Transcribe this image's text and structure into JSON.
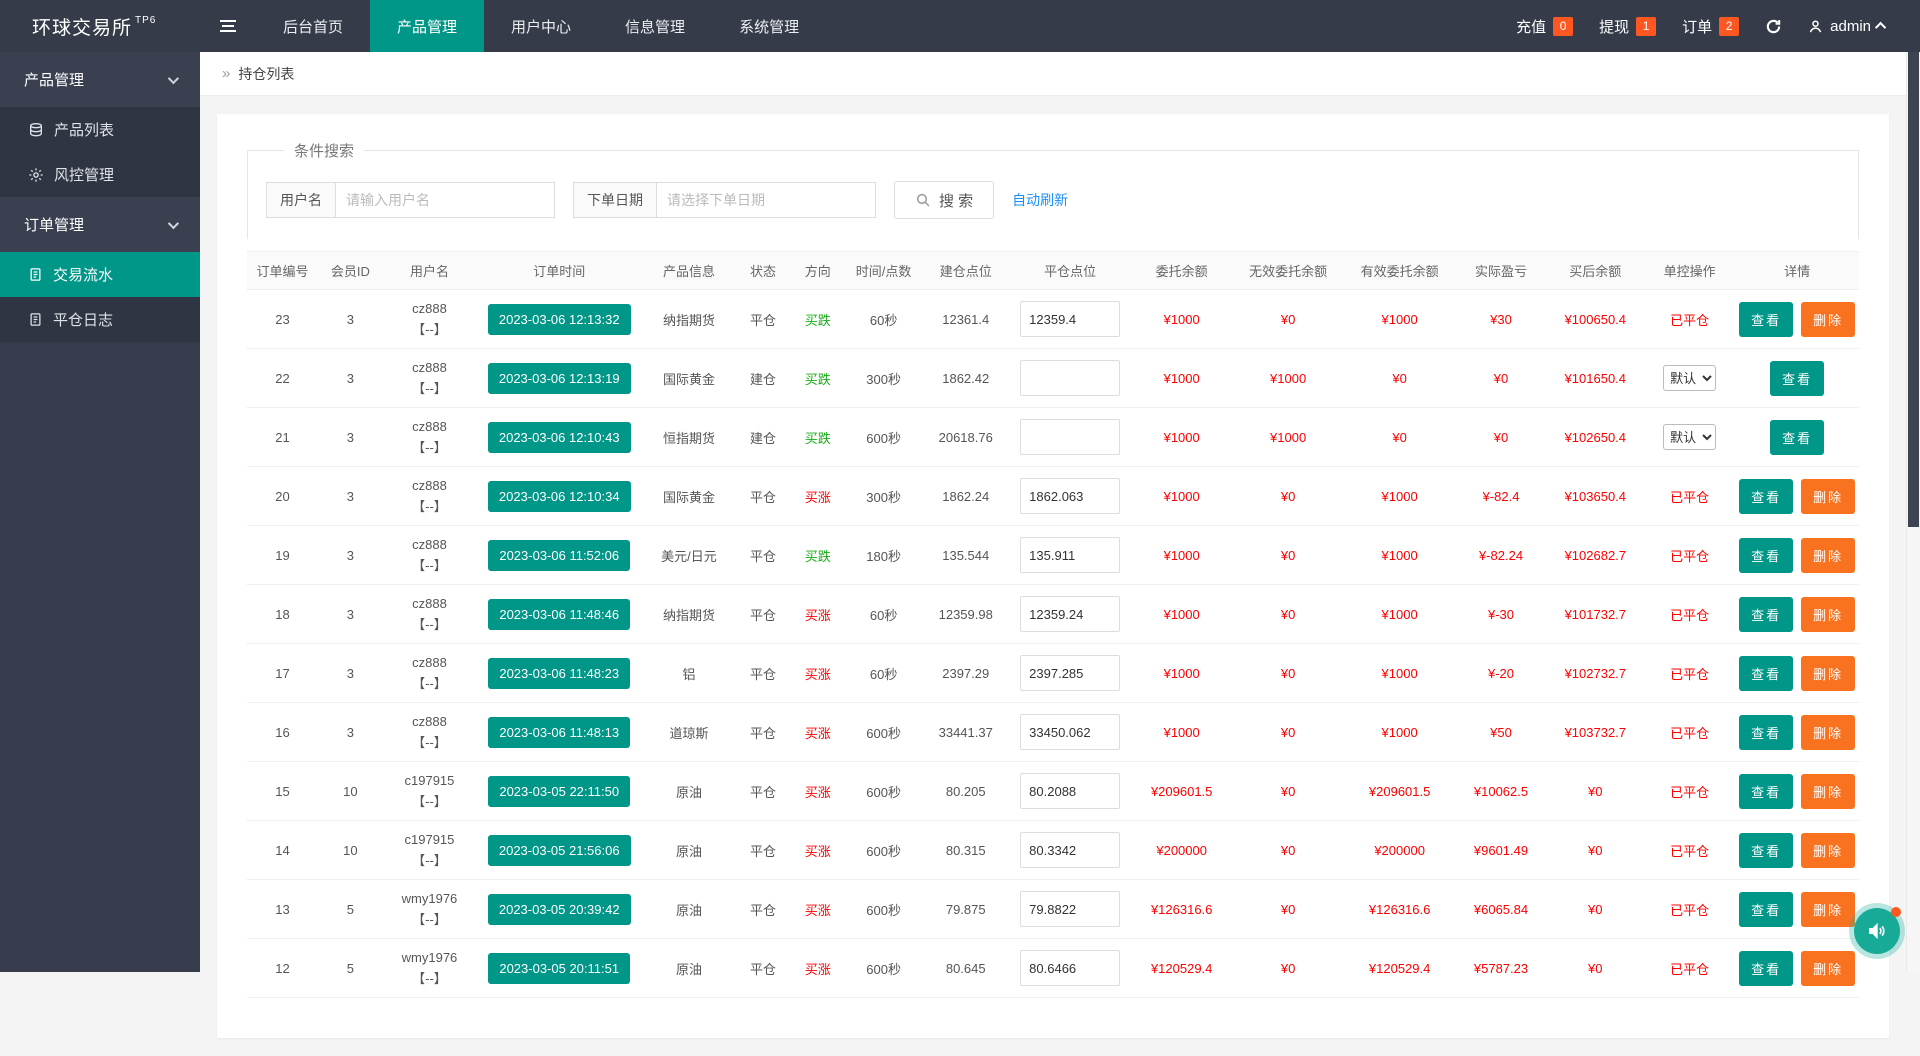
{
  "brand": {
    "title": "环球交易所",
    "superscript": "TP6"
  },
  "navbar": {
    "menu": [
      "后台首页",
      "产品管理",
      "用户中心",
      "信息管理",
      "系统管理"
    ],
    "active_index": 1,
    "quick": [
      {
        "label": "充值",
        "count": "0"
      },
      {
        "label": "提现",
        "count": "1"
      },
      {
        "label": "订单",
        "count": "2"
      }
    ],
    "user": "admin"
  },
  "sidebar": {
    "groups": [
      {
        "label": "产品管理",
        "items": [
          {
            "icon": "layers-icon",
            "label": "产品列表",
            "active": false
          },
          {
            "icon": "gear-icon",
            "label": "风控管理",
            "active": false
          }
        ]
      },
      {
        "label": "订单管理",
        "items": [
          {
            "icon": "document-icon",
            "label": "交易流水",
            "active": true
          },
          {
            "icon": "document-icon",
            "label": "平仓日志",
            "active": false
          }
        ]
      }
    ]
  },
  "breadcrumb": "持仓列表",
  "search": {
    "legend": "条件搜索",
    "username_label": "用户名",
    "username_placeholder": "请输入用户名",
    "date_label": "下单日期",
    "date_placeholder": "请选择下单日期",
    "search_button": "搜 索",
    "auto_refresh": "自动刷新"
  },
  "table": {
    "headers": [
      "订单编号",
      "会员ID",
      "用户名",
      "订单时间",
      "产品信息",
      "状态",
      "方向",
      "时间/点数",
      "建仓点位",
      "平仓点位",
      "委托余额",
      "无效委托余额",
      "有效委托余额",
      "实际盈亏",
      "买后余额",
      "单控操作",
      "详情"
    ],
    "view_label": "查看",
    "delete_label": "删除",
    "rows": [
      {
        "id": "23",
        "member_id": "3",
        "username": "cz888",
        "user_sub": "【--】",
        "time": "2023-03-06 12:13:32",
        "product": "纳指期货",
        "status": "平仓",
        "direction": "买跌",
        "direction_color": "green",
        "period": "60秒",
        "open_point": "12361.4",
        "close_point": "12359.4",
        "balance": "¥1000",
        "invalid_balance": "¥0",
        "valid_balance": "¥1000",
        "profit": "¥30",
        "after_balance": "¥100650.4",
        "control": "已平仓",
        "control_type": "text",
        "actions": [
          "查看",
          "删除"
        ]
      },
      {
        "id": "22",
        "member_id": "3",
        "username": "cz888",
        "user_sub": "【--】",
        "time": "2023-03-06 12:13:19",
        "product": "国际黄金",
        "status": "建仓",
        "direction": "买跌",
        "direction_color": "green",
        "period": "300秒",
        "open_point": "1862.42",
        "close_point": "",
        "balance": "¥1000",
        "invalid_balance": "¥1000",
        "valid_balance": "¥0",
        "profit": "¥0",
        "after_balance": "¥101650.4",
        "control": "默认",
        "control_type": "select",
        "actions": [
          "查看"
        ]
      },
      {
        "id": "21",
        "member_id": "3",
        "username": "cz888",
        "user_sub": "【--】",
        "time": "2023-03-06 12:10:43",
        "product": "恒指期货",
        "status": "建仓",
        "direction": "买跌",
        "direction_color": "green",
        "period": "600秒",
        "open_point": "20618.76",
        "close_point": "",
        "balance": "¥1000",
        "invalid_balance": "¥1000",
        "valid_balance": "¥0",
        "profit": "¥0",
        "after_balance": "¥102650.4",
        "control": "默认",
        "control_type": "select",
        "actions": [
          "查看"
        ]
      },
      {
        "id": "20",
        "member_id": "3",
        "username": "cz888",
        "user_sub": "【--】",
        "time": "2023-03-06 12:10:34",
        "product": "国际黄金",
        "status": "平仓",
        "direction": "买涨",
        "direction_color": "red",
        "period": "300秒",
        "open_point": "1862.24",
        "close_point": "1862.063",
        "balance": "¥1000",
        "invalid_balance": "¥0",
        "valid_balance": "¥1000",
        "profit": "¥-82.4",
        "after_balance": "¥103650.4",
        "control": "已平仓",
        "control_type": "text",
        "actions": [
          "查看",
          "删除"
        ]
      },
      {
        "id": "19",
        "member_id": "3",
        "username": "cz888",
        "user_sub": "【--】",
        "time": "2023-03-06 11:52:06",
        "product": "美元/日元",
        "status": "平仓",
        "direction": "买跌",
        "direction_color": "green",
        "period": "180秒",
        "open_point": "135.544",
        "close_point": "135.911",
        "balance": "¥1000",
        "invalid_balance": "¥0",
        "valid_balance": "¥1000",
        "profit": "¥-82.24",
        "after_balance": "¥102682.7",
        "control": "已平仓",
        "control_type": "text",
        "actions": [
          "查看",
          "删除"
        ]
      },
      {
        "id": "18",
        "member_id": "3",
        "username": "cz888",
        "user_sub": "【--】",
        "time": "2023-03-06 11:48:46",
        "product": "纳指期货",
        "status": "平仓",
        "direction": "买涨",
        "direction_color": "red",
        "period": "60秒",
        "open_point": "12359.98",
        "close_point": "12359.24",
        "balance": "¥1000",
        "invalid_balance": "¥0",
        "valid_balance": "¥1000",
        "profit": "¥-30",
        "after_balance": "¥101732.7",
        "control": "已平仓",
        "control_type": "text",
        "actions": [
          "查看",
          "删除"
        ]
      },
      {
        "id": "17",
        "member_id": "3",
        "username": "cz888",
        "user_sub": "【--】",
        "time": "2023-03-06 11:48:23",
        "product": "铝",
        "status": "平仓",
        "direction": "买涨",
        "direction_color": "red",
        "period": "60秒",
        "open_point": "2397.29",
        "close_point": "2397.285",
        "balance": "¥1000",
        "invalid_balance": "¥0",
        "valid_balance": "¥1000",
        "profit": "¥-20",
        "after_balance": "¥102732.7",
        "control": "已平仓",
        "control_type": "text",
        "actions": [
          "查看",
          "删除"
        ]
      },
      {
        "id": "16",
        "member_id": "3",
        "username": "cz888",
        "user_sub": "【--】",
        "time": "2023-03-06 11:48:13",
        "product": "道琼斯",
        "status": "平仓",
        "direction": "买涨",
        "direction_color": "red",
        "period": "600秒",
        "open_point": "33441.37",
        "close_point": "33450.062",
        "balance": "¥1000",
        "invalid_balance": "¥0",
        "valid_balance": "¥1000",
        "profit": "¥50",
        "after_balance": "¥103732.7",
        "control": "已平仓",
        "control_type": "text",
        "actions": [
          "查看",
          "删除"
        ]
      },
      {
        "id": "15",
        "member_id": "10",
        "username": "c197915",
        "user_sub": "【--】",
        "time": "2023-03-05 22:11:50",
        "product": "原油",
        "status": "平仓",
        "direction": "买涨",
        "direction_color": "red",
        "period": "600秒",
        "open_point": "80.205",
        "close_point": "80.2088",
        "balance": "¥209601.5",
        "invalid_balance": "¥0",
        "valid_balance": "¥209601.5",
        "profit": "¥10062.5",
        "after_balance": "¥0",
        "control": "已平仓",
        "control_type": "text",
        "actions": [
          "查看",
          "删除"
        ]
      },
      {
        "id": "14",
        "member_id": "10",
        "username": "c197915",
        "user_sub": "【--】",
        "time": "2023-03-05 21:56:06",
        "product": "原油",
        "status": "平仓",
        "direction": "买涨",
        "direction_color": "red",
        "period": "600秒",
        "open_point": "80.315",
        "close_point": "80.3342",
        "balance": "¥200000",
        "invalid_balance": "¥0",
        "valid_balance": "¥200000",
        "profit": "¥9601.49",
        "after_balance": "¥0",
        "control": "已平仓",
        "control_type": "text",
        "actions": [
          "查看",
          "删除"
        ]
      },
      {
        "id": "13",
        "member_id": "5",
        "username": "wmy1976",
        "user_sub": "【--】",
        "time": "2023-03-05 20:39:42",
        "product": "原油",
        "status": "平仓",
        "direction": "买涨",
        "direction_color": "red",
        "period": "600秒",
        "open_point": "79.875",
        "close_point": "79.8822",
        "balance": "¥126316.6",
        "invalid_balance": "¥0",
        "valid_balance": "¥126316.6",
        "profit": "¥6065.84",
        "after_balance": "¥0",
        "control": "已平仓",
        "control_type": "text",
        "actions": [
          "查看",
          "删除"
        ]
      },
      {
        "id": "12",
        "member_id": "5",
        "username": "wmy1976",
        "user_sub": "【--】",
        "time": "2023-03-05 20:11:51",
        "product": "原油",
        "status": "平仓",
        "direction": "买涨",
        "direction_color": "red",
        "period": "600秒",
        "open_point": "80.645",
        "close_point": "80.6466",
        "balance": "¥120529.4",
        "invalid_balance": "¥0",
        "valid_balance": "¥120529.4",
        "profit": "¥5787.23",
        "after_balance": "¥0",
        "control": "已平仓",
        "control_type": "text",
        "actions": [
          "查看",
          "删除"
        ]
      }
    ]
  },
  "colors": {
    "accent_teal": "#009688",
    "delete_orange": "#f9721f",
    "badge_orange": "#ff5722",
    "money_red": "#fe0000",
    "direction_green": "#17ad17",
    "link_blue": "#1890ff",
    "navbar_bg": "#353b48",
    "sidebar_bg": "#363c4b"
  }
}
